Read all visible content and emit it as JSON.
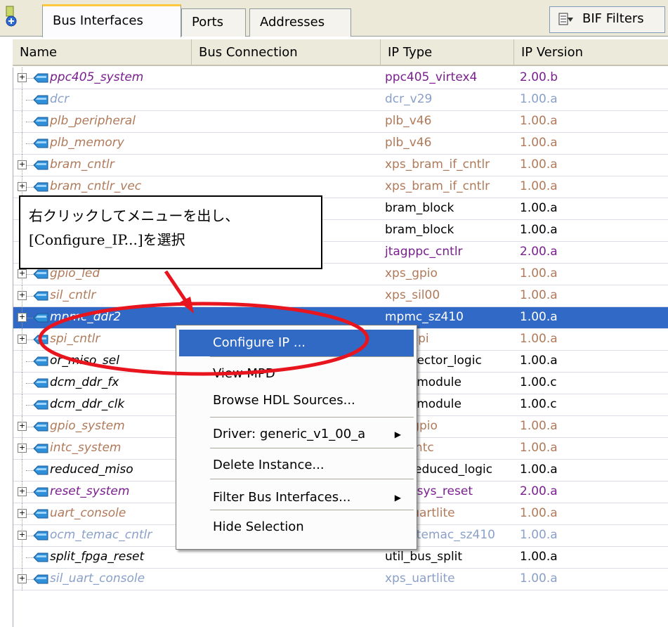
{
  "tabs": [
    "Bus Interfaces",
    "Ports",
    "Addresses"
  ],
  "filter_button": "BIF Filters",
  "columns": [
    "Name",
    "Bus Connection",
    "IP Type",
    "IP Version"
  ],
  "rows": [
    {
      "name": "ppc405_system",
      "type": "ppc405_virtex4",
      "version": "2.00.b",
      "color": "#7a1f8f",
      "expander": true
    },
    {
      "name": "dcr",
      "type": "dcr_v29",
      "version": "1.00.a",
      "color": "#8aa0c8",
      "expander": false
    },
    {
      "name": "plb_peripheral",
      "type": "plb_v46",
      "version": "1.00.a",
      "color": "#b07a5a",
      "expander": false
    },
    {
      "name": "plb_memory",
      "type": "plb_v46",
      "version": "1.00.a",
      "color": "#b07a5a",
      "expander": false
    },
    {
      "name": "bram_cntlr",
      "type": "xps_bram_if_cntlr",
      "version": "1.00.a",
      "color": "#b07a5a",
      "expander": true
    },
    {
      "name": "bram_cntlr_vec",
      "type": "xps_bram_if_cntlr",
      "version": "1.00.a",
      "color": "#b07a5a",
      "expander": true
    },
    {
      "name": "",
      "type": "bram_block",
      "version": "1.00.a",
      "color": "#000000",
      "expander": false
    },
    {
      "name": "",
      "type": "bram_block",
      "version": "1.00.a",
      "color": "#000000",
      "expander": false
    },
    {
      "name": "",
      "type": "jtagppc_cntlr",
      "version": "2.00.a",
      "color": "#7a1f8f",
      "expander": false
    },
    {
      "name": "gpio_led",
      "type": "xps_gpio",
      "version": "1.00.a",
      "color": "#b07a5a",
      "expander": true
    },
    {
      "name": "sil_cntlr",
      "type": "xps_sil00",
      "version": "1.00.a",
      "color": "#b07a5a",
      "expander": true
    },
    {
      "name": "mpmc_ddr2",
      "type": "mpmc_sz410",
      "version": "1.00.a",
      "color": "#ffffff",
      "expander": true,
      "selected": true
    },
    {
      "name": "spi_cntlr",
      "type": "xps_spi",
      "version": "1.00.a",
      "color": "#b07a5a",
      "expander": true
    },
    {
      "name": "or_miso_sel",
      "type": "util_vector_logic",
      "version": "1.00.a",
      "color": "#000000",
      "expander": false
    },
    {
      "name": "dcm_ddr_fx",
      "type": "dcm_module",
      "version": "1.00.c",
      "color": "#000000",
      "expander": false
    },
    {
      "name": "dcm_ddr_clk",
      "type": "dcm_module",
      "version": "1.00.c",
      "color": "#000000",
      "expander": false
    },
    {
      "name": "gpio_system",
      "type": "xps_gpio",
      "version": "1.00.a",
      "color": "#b07a5a",
      "expander": true
    },
    {
      "name": "intc_system",
      "type": "xps_intc",
      "version": "1.00.a",
      "color": "#b07a5a",
      "expander": true
    },
    {
      "name": "reduced_miso",
      "type": "util_reduced_logic",
      "version": "1.00.a",
      "color": "#000000",
      "expander": false
    },
    {
      "name": "reset_system",
      "type": "proc_sys_reset",
      "version": "2.00.a",
      "color": "#7a1f8f",
      "expander": true
    },
    {
      "name": "uart_console",
      "type": "xps_uartlite",
      "version": "1.00.a",
      "color": "#b07a5a",
      "expander": true
    },
    {
      "name": "ocm_temac_cntlr",
      "type": "ocm_temac_sz410",
      "version": "1.00.a",
      "color": "#8aa0c8",
      "expander": true
    },
    {
      "name": "split_fpga_reset",
      "type": "util_bus_split",
      "version": "1.00.a",
      "color": "#000000",
      "expander": false
    },
    {
      "name": "sil_uart_console",
      "type": "xps_uartlite",
      "version": "1.00.a",
      "color": "#8aa0c8",
      "expander": true
    }
  ],
  "callout": {
    "line1": "右クリックしてメニューを出し、",
    "line2": "[Configure_IP...]を選択"
  },
  "context_menu": {
    "items": [
      {
        "label": "Configure IP ...",
        "highlighted": true
      },
      {
        "label": "View MPD"
      },
      {
        "label": "Browse HDL Sources..."
      },
      {
        "label": "Driver: generic_v1_00_a",
        "submenu": true
      },
      {
        "label": "Delete Instance..."
      },
      {
        "label": "Filter Bus Interfaces...",
        "submenu": true
      },
      {
        "label": "Hide Selection"
      }
    ]
  },
  "colors": {
    "selection": "#3169c6",
    "annotation_red": "#e8141e",
    "active_tab_accent": "#ffc83c"
  }
}
